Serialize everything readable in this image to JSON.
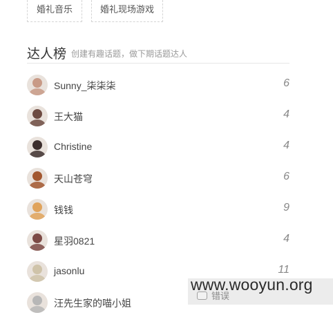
{
  "tags": [
    "婚礼音乐",
    "婚礼现场游戏"
  ],
  "section": {
    "title": "达人榜",
    "subtitle": "创建有趣话题，做下期话题达人"
  },
  "leaders": [
    {
      "name": "Sunny_柒柒柒",
      "count": "6"
    },
    {
      "name": "王大猫",
      "count": "4"
    },
    {
      "name": "Christine",
      "count": "4"
    },
    {
      "name": "天山苍穹",
      "count": "6"
    },
    {
      "name": "钱钱",
      "count": "9"
    },
    {
      "name": "星羽0821",
      "count": "4"
    },
    {
      "name": "jasonlu",
      "count": "11"
    },
    {
      "name": "汪先生家的喵小姐",
      "count": ""
    }
  ],
  "watermark": "www.wooyun.org",
  "report_label": "错误",
  "colors": {
    "avatars": [
      "#c89a86",
      "#6d4b42",
      "#3d2f2e",
      "#a2572f",
      "#e0a35b",
      "#7c4a45",
      "#cfc3a9",
      "#b7b7b7"
    ]
  }
}
